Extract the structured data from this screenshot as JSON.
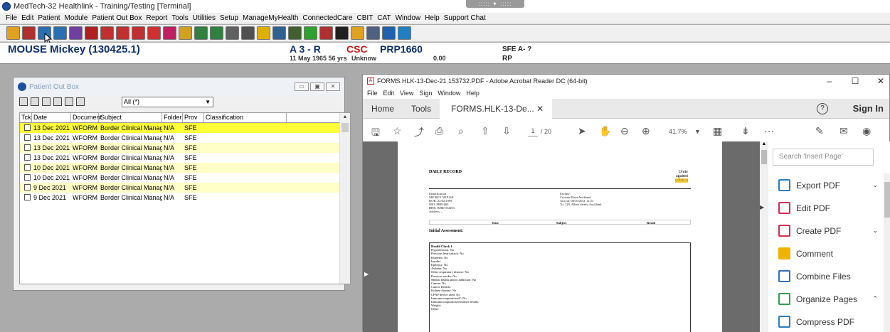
{
  "app": {
    "title": "MedTech-32 Healthlink - Training/Testing [Terminal]",
    "menu": [
      "File",
      "Edit",
      "Patient",
      "Module",
      "Patient Out Box",
      "Report",
      "Tools",
      "Utilities",
      "Setup",
      "ManageMyHealth",
      "ConnectedCare",
      "CBIT",
      "CAT",
      "Window",
      "Help",
      "Support Chat"
    ]
  },
  "patient": {
    "name": "MOUSE Mickey (130425.1)",
    "code": "A 3 - R",
    "dob": "11 May 1965 56 yrs",
    "csc": "CSC",
    "prp": "PRP1660",
    "unknown": "Unknow",
    "amount": "0.00",
    "sfe": "SFE A- ?",
    "rp": "RP"
  },
  "outbox": {
    "title": "Patient Out Box",
    "filter": "All (*)",
    "columns": [
      "Tck",
      "Date",
      "Document",
      "Subject",
      "Folder",
      "Prov",
      "Classification"
    ],
    "rows": [
      {
        "date": "13 Dec 2021",
        "doc": "WFORM",
        "subject": "Border Clinical Manageme",
        "folder": "N/A",
        "prov": "SFE",
        "class": ""
      },
      {
        "date": "13 Dec 2021",
        "doc": "WFORM",
        "subject": "Border Clinical Manageme",
        "folder": "N/A",
        "prov": "SFE",
        "class": ""
      },
      {
        "date": "13 Dec 2021",
        "doc": "WFORM",
        "subject": "Border Clinical Manageme",
        "folder": "N/A",
        "prov": "SFE",
        "class": ""
      },
      {
        "date": "13 Dec 2021",
        "doc": "WFORM",
        "subject": "Border Clinical Manageme",
        "folder": "N/A",
        "prov": "SFE",
        "class": ""
      },
      {
        "date": "10 Dec 2021",
        "doc": "WFORM",
        "subject": "Border Clinical Manageme",
        "folder": "N/A",
        "prov": "SFE",
        "class": ""
      },
      {
        "date": "10 Dec 2021",
        "doc": "WFORM",
        "subject": "Border Clinical Manageme",
        "folder": "N/A",
        "prov": "SFE",
        "class": ""
      },
      {
        "date": "9 Dec 2021",
        "doc": "WFORM",
        "subject": "Border Clinical Manageme",
        "folder": "N/A",
        "prov": "SFE",
        "class": ""
      },
      {
        "date": "9 Dec 2021",
        "doc": "WFORM",
        "subject": "Border Clinical Manageme",
        "folder": "N/A",
        "prov": "SFE",
        "class": ""
      }
    ]
  },
  "acrobat": {
    "title": "FORMS.HLK-13-Dec-21 153732.PDF - Adobe Acrobat Reader DC (64-bit)",
    "menu": [
      "File",
      "Edit",
      "View",
      "Sign",
      "Window",
      "Help"
    ],
    "tabs": {
      "home": "Home",
      "tools": "Tools",
      "doc": "FORMS.HLK-13-De..."
    },
    "signin": "Sign In",
    "page_current": "1",
    "page_total": "/ 20",
    "zoom": "41.7%",
    "search_placeholder": "Search 'Insert Page'",
    "tools_list": [
      "Export PDF",
      "Edit PDF",
      "Create PDF",
      "Comment",
      "Combine Files",
      "Organize Pages",
      "Compress PDF"
    ]
  },
  "doc": {
    "heading": "DAILY RECORD",
    "unite": "Unite",
    "against": "against",
    "covid": "COVID-19",
    "left_lines": [
      "Identification",
      "MICKEY MOUSE",
      "DOB: 22/02/1999",
      "NHI: PRP1660",
      "BHR: BHR-054293",
      "Address: ,"
    ],
    "right_lines": [
      "Facility:",
      "Crowne Plaza Auckland",
      "Arrival: 08/10/2021 11:53",
      "To: 128, Albert Street, Auckland"
    ],
    "table_cols": [
      "Date",
      "Subject",
      "Result"
    ],
    "initial": "Initial Assessment:",
    "health_lines": [
      "Health Check 1",
      "Hypertension: No",
      "Previous heart attack: No",
      "Diabetes: No",
      "Insulin:",
      "Epilepsy: No",
      "Asthma: No",
      "Other respiratory disease: No",
      "Previous stroke: No",
      "Mental health and/or addiction: No",
      "Cancer: No",
      "Cancer Details:",
      "Kidney disease: No",
      "CPAP device used: No",
      "Immunocompromised?: No",
      "Immunocompromised further details:",
      "Weight:",
      "Other:"
    ]
  }
}
